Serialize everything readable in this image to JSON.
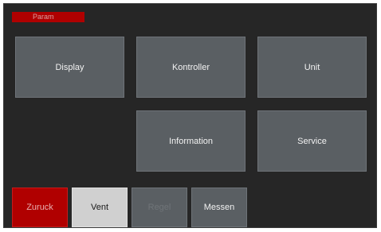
{
  "header": {
    "title": "Param"
  },
  "menu": {
    "display_label": "Display",
    "kontroller_label": "Kontroller",
    "unit_label": "Unit",
    "information_label": "Information",
    "service_label": "Service"
  },
  "footer": {
    "zuruck_label": "Zuruck",
    "vent_label": "Vent",
    "regel_label": "Regel",
    "messen_label": "Messen"
  },
  "colors": {
    "background": "#262626",
    "tile": "#5a5f63",
    "accent_red": "#b00000",
    "selected": "#d0d0d0"
  }
}
